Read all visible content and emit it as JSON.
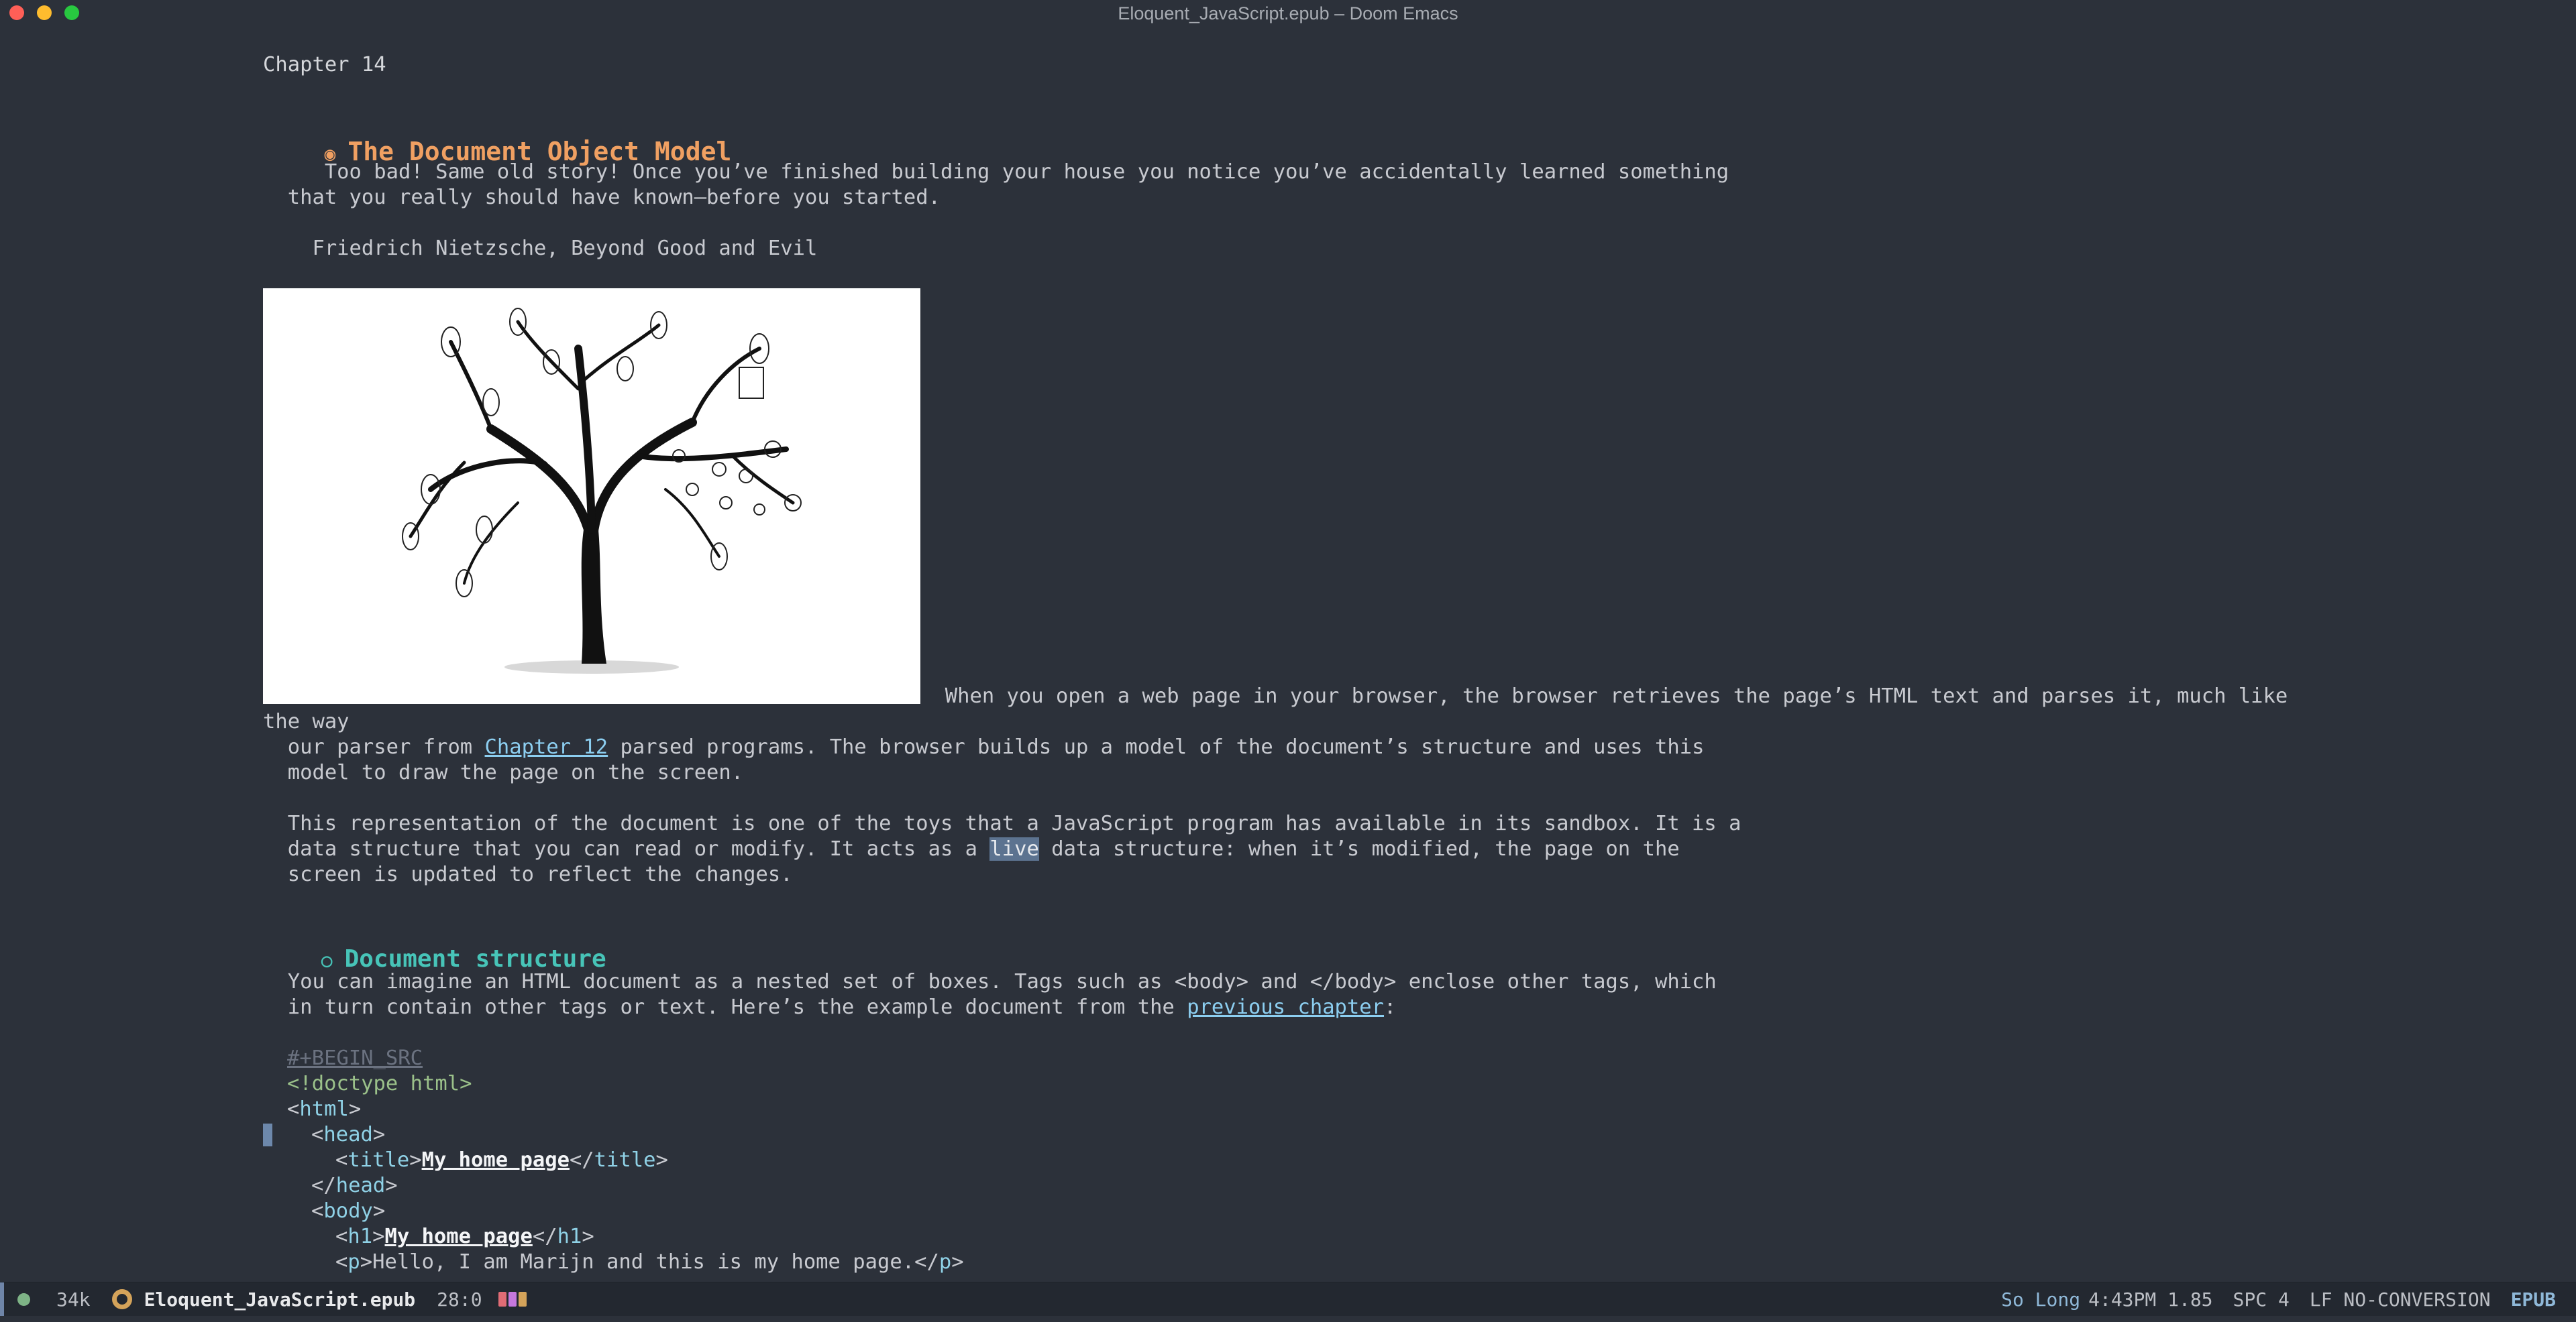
{
  "window": {
    "title": "Eloquent_JavaScript.epub – Doom Emacs"
  },
  "buffer": {
    "chapter_label": "Chapter 14",
    "heading1": "The Document Object Model",
    "heading1_bullet": "◉",
    "epigraph_line1": "     Too bad! Same old story! Once you’ve finished building your house you notice you’ve accidentally learned something",
    "epigraph_line2": "  that you really should have known—before you started.",
    "epigraph_author": "    Friedrich Nietzsche, Beyond Good and Evil",
    "para1_line1": "  When you open a web page in your browser, the browser retrieves the page’s HTML text and parses it, much like",
    "para1_line2": "the way",
    "para1_line3_a": "  our parser from ",
    "para1_line3_link": "Chapter 12",
    "para1_line3_b": " parsed programs. The browser builds up a model of the document’s structure and uses this",
    "para1_line4": "  model to draw the page on the screen.",
    "para2_line1": "  This representation of the document is one of the toys that a JavaScript program has available in its sandbox. It is a",
    "para2_line2_a": "  data structure that you can read or modify. It acts as a ",
    "para2_line2_hl": "live",
    "para2_line2_b": " data structure: when it’s modified, the page on the",
    "para2_line3": "  screen is updated to reflect the changes.",
    "heading2": "Document structure",
    "heading2_bullet": "○",
    "para3_line1": "  You can imagine an HTML document as a nested set of boxes. Tags such as <body> and </body> enclose other tags, which",
    "para3_line2_a": "  in turn contain other tags or text. Here’s the example document from the ",
    "para3_line2_link": "previous chapter",
    "para3_line2_b": ":",
    "src_begin": "#+BEGIN_SRC",
    "code": {
      "doctype": "<!doctype html>",
      "html_open": "html",
      "head_open": "head",
      "title_tag": "title",
      "title_text": "My home page",
      "head_close": "head",
      "body_open": "body",
      "h1_tag": "h1",
      "h1_text": "My home page",
      "p_tag": "p",
      "p_text": "Hello, I am Marijn and this is my home page."
    }
  },
  "modeline": {
    "size": "34k",
    "filename": "Eloquent_JavaScript.epub",
    "position": "28:0",
    "song": "So Long",
    "time": "4:43PM 1.85",
    "indent": "SPC 4",
    "encoding": "LF NO-CONVERSION",
    "mode": "EPUB"
  }
}
